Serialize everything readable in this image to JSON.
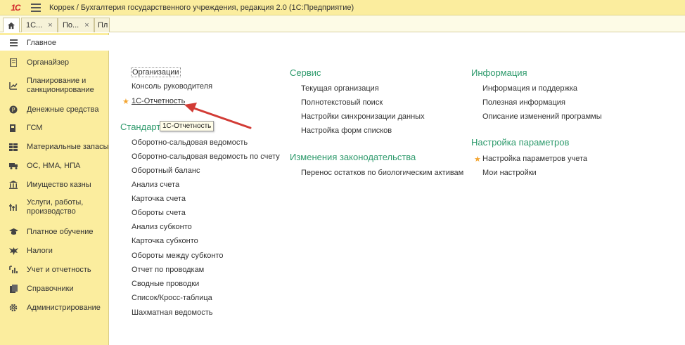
{
  "app": {
    "logo": "1С",
    "title": "Коррек / Бухгалтерия государственного учреждения, редакция 2.0  (1С:Предприятие)"
  },
  "tabs": [
    {
      "label": "1С..."
    },
    {
      "label": "По..."
    },
    {
      "label": "Пл"
    }
  ],
  "sidebar": {
    "items": [
      {
        "label": "Главное",
        "icon": "menu-lines-icon"
      },
      {
        "label": "Органайзер",
        "icon": "notebook-icon"
      },
      {
        "label": "Планирование и санкционирование",
        "icon": "planning-icon"
      },
      {
        "label": "Денежные средства",
        "icon": "coin-icon"
      },
      {
        "label": "ГСМ",
        "icon": "fuel-icon"
      },
      {
        "label": "Материальные запасы",
        "icon": "grid-icon"
      },
      {
        "label": "ОС, НМА, НПА",
        "icon": "truck-icon"
      },
      {
        "label": "Имущество казны",
        "icon": "building-icon"
      },
      {
        "label": "Услуги, работы, производство",
        "icon": "tools-icon"
      },
      {
        "label": "Платное обучение",
        "icon": "graduation-cap-icon"
      },
      {
        "label": "Налоги",
        "icon": "eagle-icon"
      },
      {
        "label": "Учет и отчетность",
        "icon": "chart-icon"
      },
      {
        "label": "Справочники",
        "icon": "books-icon"
      },
      {
        "label": "Администрирование",
        "icon": "gear-icon"
      }
    ]
  },
  "main": {
    "col1": {
      "top_links": [
        "Организации",
        "Консоль руководителя",
        "1С-Отчетность"
      ],
      "section_title": "Стандарт",
      "links": [
        "Оборотно-сальдовая ведомость",
        "Оборотно-сальдовая ведомость по счету",
        "Оборотный баланс",
        "Анализ счета",
        "Карточка счета",
        "Обороты счета",
        "Анализ субконто",
        "Карточка субконто",
        "Обороты между субконто",
        "Отчет по проводкам",
        "Сводные проводки",
        "Список/Кросс-таблица",
        "Шахматная ведомость"
      ]
    },
    "col2": {
      "section1_title": "Сервис",
      "section1_links": [
        "Текущая организация",
        "Полнотекстовый поиск",
        "Настройки синхронизации данных",
        "Настройка форм списков"
      ],
      "section2_title": "Изменения законодательства",
      "section2_links": [
        "Перенос остатков по биологическим активам"
      ]
    },
    "col3": {
      "section1_title": "Информация",
      "section1_links": [
        "Информация и поддержка",
        "Полезная информация",
        "Описание изменений программы"
      ],
      "section2_title": "Настройка параметров",
      "section2_links": [
        "Настройка параметров учета",
        "Мои настройки"
      ]
    },
    "tooltip": "1С-Отчетность"
  },
  "colors": {
    "sidebar_bg": "#fbed9e",
    "section_title": "#2e9a6c",
    "star": "#f3a531",
    "arrow": "#d23b35"
  }
}
